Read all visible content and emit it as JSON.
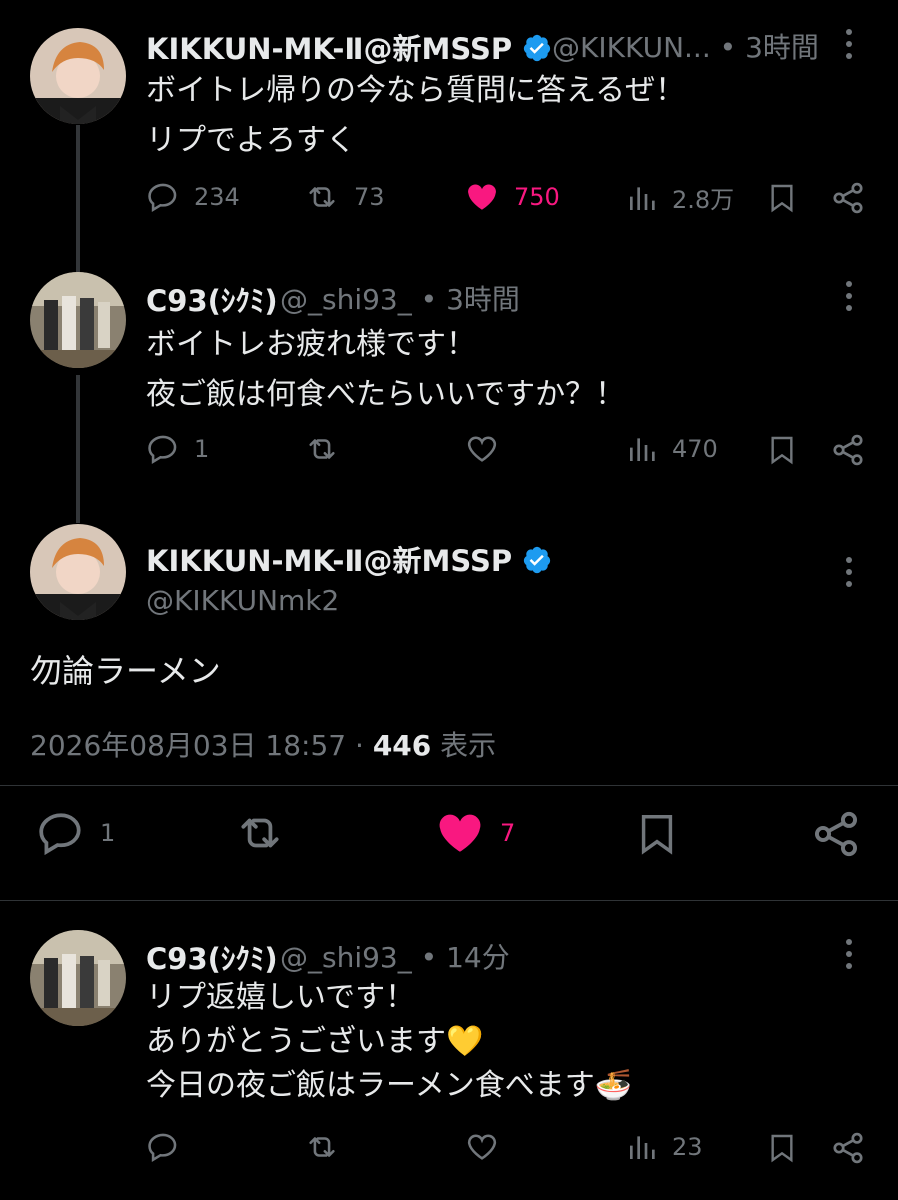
{
  "tweets": [
    {
      "name": "KIKKUN-MK-Ⅱ@新MSSP",
      "handle": "@KIKKUN...",
      "time": "3時間",
      "lines": [
        "ボイトレ帰りの今なら質問に答えるぜ！",
        "リプでよろすく"
      ],
      "replies": "234",
      "retweets": "73",
      "likes": "750",
      "views": "2.8万"
    },
    {
      "name": "C93(ｼｸﾐ)",
      "handle": "@_shi93_",
      "time": "3時間",
      "lines": [
        "ボイトレお疲れ様です！",
        "夜ご飯は何食べたらいいですか？！"
      ],
      "replies": "1",
      "retweets": "",
      "likes": "",
      "views": "470"
    }
  ],
  "focused": {
    "name": "KIKKUN-MK-Ⅱ@新MSSP",
    "handle": "@KIKKUNmk2",
    "text": "勿論ラーメン",
    "datetime": "2026年08月03日 18:57",
    "views": "446",
    "views_label": "表示",
    "replies": "1",
    "likes": "7"
  },
  "reply": {
    "name": "C93(ｼｸﾐ)",
    "handle": "@_shi93_",
    "time": "14分",
    "lines": [
      "リプ返嬉しいです！",
      "ありがとうございます💛",
      "今日の夜ご飯はラーメン食べます🍜"
    ],
    "views": "23"
  },
  "colors": {
    "like": "#f91880",
    "verified": "#1d9bf0",
    "muted": "#71767b",
    "background": "#000000"
  }
}
